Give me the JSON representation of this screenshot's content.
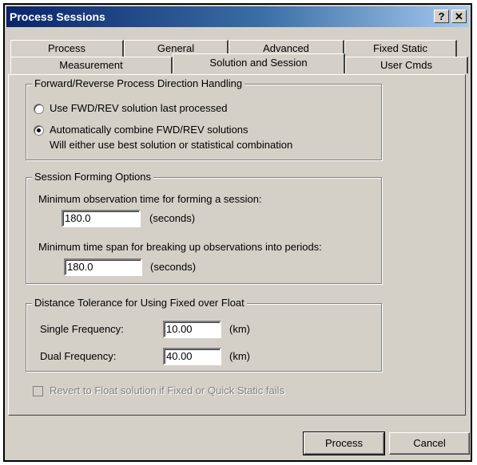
{
  "window": {
    "title": "Process Sessions",
    "help_label": "?",
    "close_label": "✕"
  },
  "tabs_row_back": [
    "Process",
    "General",
    "Advanced",
    "Fixed Static"
  ],
  "tabs_row_front": [
    "Measurement",
    "Solution and Session",
    "User Cmds"
  ],
  "active_tab": "Solution and Session",
  "direction": {
    "legend": "Forward/Reverse Process Direction Handling",
    "option_last": "Use FWD/REV solution last processed",
    "option_combine": "Automatically combine FWD/REV solutions",
    "option_combine_note": "Will either use best solution or statistical combination",
    "selected": "option_combine"
  },
  "session": {
    "legend": "Session Forming Options",
    "min_obs_label": "Minimum observation time for forming a session:",
    "min_obs_value": "180.0",
    "min_obs_unit": "(seconds)",
    "min_span_label": "Minimum time span for breaking up observations into periods:",
    "min_span_value": "180.0",
    "min_span_unit": "(seconds)"
  },
  "distance": {
    "legend": "Distance Tolerance for Using Fixed over Float",
    "single_label": "Single Frequency:",
    "single_value": "10.00",
    "single_unit": "(km)",
    "dual_label": "Dual Frequency:",
    "dual_value": "40.00",
    "dual_unit": "(km)"
  },
  "revert": {
    "label": "Revert to Float solution if Fixed or Quick Static fails",
    "checked": false,
    "enabled": false
  },
  "buttons": {
    "process": "Process",
    "cancel": "Cancel"
  }
}
